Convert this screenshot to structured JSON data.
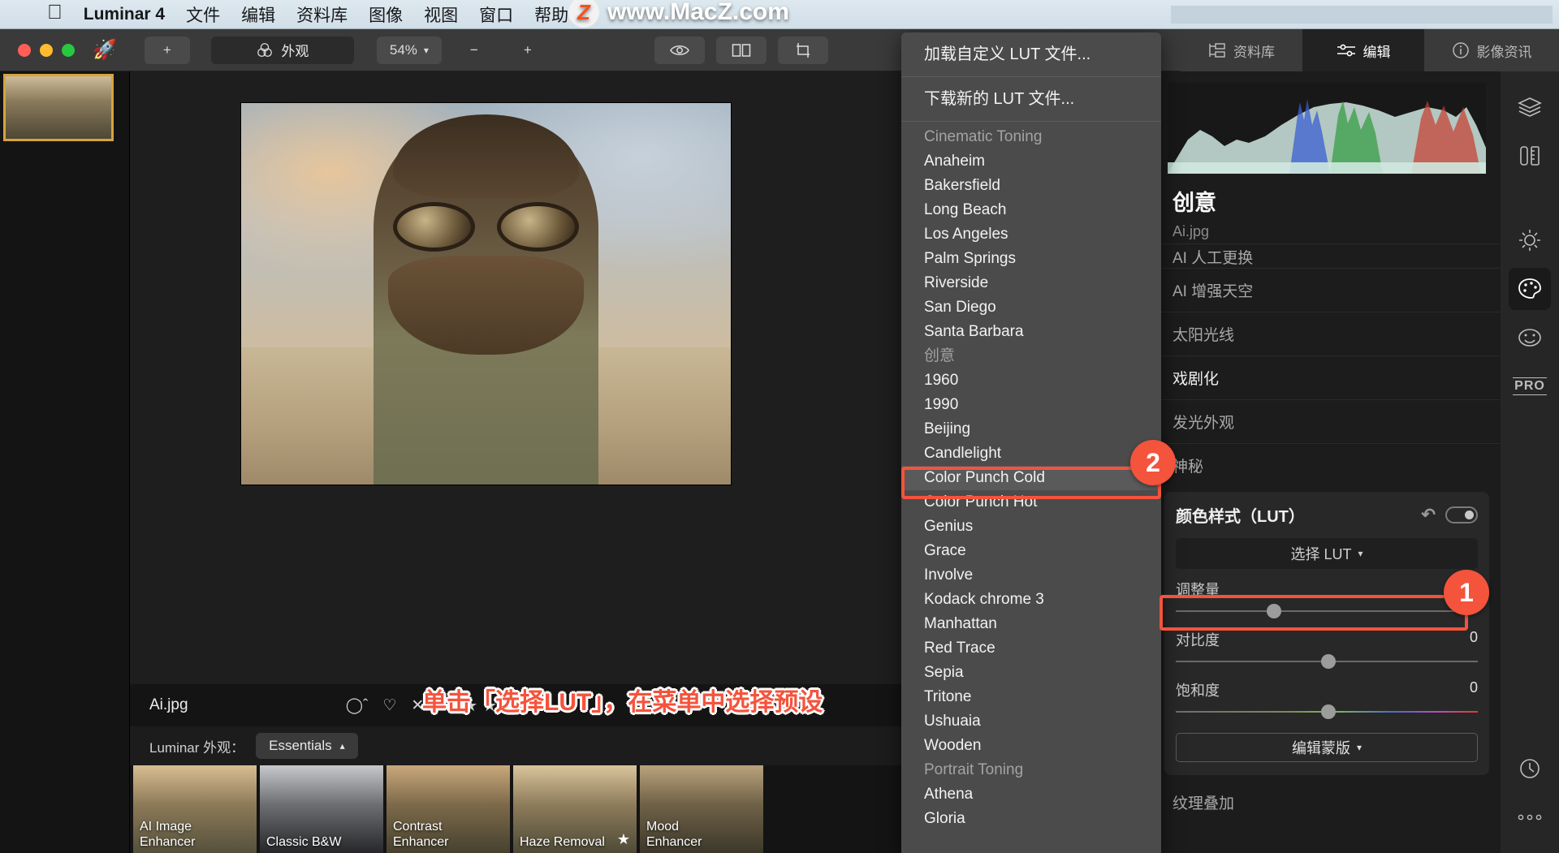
{
  "macbar": {
    "apple_icon": "apple-logo-icon",
    "app_name": "Luminar 4",
    "menus": [
      "文件",
      "编辑",
      "资料库",
      "图像",
      "视图",
      "窗口",
      "帮助"
    ]
  },
  "watermark": {
    "badge": "Z",
    "text": "www.MacZ.com"
  },
  "toolbar": {
    "add_label": "+",
    "looks_label": "外观",
    "zoom_label": "54%",
    "zoom_out": "−",
    "zoom_in": "+",
    "eye_icon": "eye-icon",
    "compare_icon": "split-view-icon",
    "crop_icon": "crop-icon",
    "tabs": [
      {
        "label": "资料库",
        "icon": "library-icon",
        "active": false
      },
      {
        "label": "编辑",
        "icon": "sliders-icon",
        "active": true
      },
      {
        "label": "影像资讯",
        "icon": "info-icon",
        "active": false
      }
    ]
  },
  "canvas": {
    "filename": "Ai.jpg"
  },
  "infobar": {
    "filename": "Ai.jpg",
    "reject_icon": "circle-icon",
    "favorite_icon": "heart-icon",
    "close_icon": "x-icon",
    "stars": [
      "★",
      "★",
      "★",
      "★",
      "★"
    ]
  },
  "looksbar": {
    "label": "Luminar 外观：",
    "collection": "Essentials"
  },
  "presets": [
    {
      "label": "AI Image\nEnhancer",
      "starred": false
    },
    {
      "label": "Classic B&W",
      "starred": false
    },
    {
      "label": "Contrast\nEnhancer",
      "starred": false
    },
    {
      "label": "Haze Removal",
      "starred": true
    },
    {
      "label": "Mood\nEnhancer",
      "starred": false
    }
  ],
  "rightpanel": {
    "title": "创意",
    "subtitle": "Ai.jpg",
    "rows": [
      {
        "label": "AI 人工更换",
        "strong": false
      },
      {
        "label": "AI 增强天空",
        "strong": false
      },
      {
        "label": "太阳光线",
        "strong": false
      },
      {
        "label": "戏剧化",
        "strong": true
      },
      {
        "label": "发光外观",
        "strong": false
      },
      {
        "label": "神秘",
        "strong": false
      }
    ],
    "lut_card": {
      "title": "颜色样式（LUT）",
      "reset_icon": "undo-icon",
      "toggle_icon": "toggle-switch",
      "select_label": "选择 LUT",
      "select_chevron": "chevron-down-icon",
      "sliders": [
        {
          "label": "调整量",
          "value": "30",
          "pos": 30,
          "rainbow": false
        },
        {
          "label": "对比度",
          "value": "0",
          "pos": 50,
          "rainbow": false
        },
        {
          "label": "饱和度",
          "value": "0",
          "pos": 50,
          "rainbow": true
        }
      ],
      "mask_label": "编辑蒙版"
    },
    "after_card": "纹理叠加"
  },
  "rail": {
    "icons": [
      {
        "name": "layers-icon",
        "active": false
      },
      {
        "name": "tools-icon",
        "active": false
      },
      {
        "name": "essentials-sun-icon",
        "active": false
      },
      {
        "name": "creative-palette-icon",
        "active": true
      },
      {
        "name": "portrait-face-icon",
        "active": false
      },
      {
        "name": "pro-icon",
        "active": false
      },
      {
        "name": "history-clock-icon",
        "active": false
      },
      {
        "name": "more-dots-icon",
        "active": false
      }
    ],
    "pro_label": "PRO"
  },
  "lut_menu": {
    "actions": [
      "加载自定义 LUT 文件...",
      "下载新的 LUT 文件..."
    ],
    "items": [
      {
        "label": "Cinematic Toning",
        "type": "header"
      },
      {
        "label": "Anaheim",
        "type": "item"
      },
      {
        "label": "Bakersfield",
        "type": "item"
      },
      {
        "label": "Long Beach",
        "type": "item"
      },
      {
        "label": "Los Angeles",
        "type": "item"
      },
      {
        "label": "Palm Springs",
        "type": "item"
      },
      {
        "label": "Riverside",
        "type": "item"
      },
      {
        "label": "San Diego",
        "type": "item"
      },
      {
        "label": "Santa Barbara",
        "type": "item"
      },
      {
        "label": "创意",
        "type": "header"
      },
      {
        "label": "1960",
        "type": "item"
      },
      {
        "label": "1990",
        "type": "item"
      },
      {
        "label": "Beijing",
        "type": "item"
      },
      {
        "label": "Candlelight",
        "type": "item"
      },
      {
        "label": "Color Punch Cold",
        "type": "item",
        "selected": true
      },
      {
        "label": "Color Punch Hot",
        "type": "item"
      },
      {
        "label": "Genius",
        "type": "item"
      },
      {
        "label": "Grace",
        "type": "item"
      },
      {
        "label": "Involve",
        "type": "item"
      },
      {
        "label": "Kodack chrome  3",
        "type": "item"
      },
      {
        "label": "Manhattan",
        "type": "item"
      },
      {
        "label": "Red Trace",
        "type": "item"
      },
      {
        "label": "Sepia",
        "type": "item"
      },
      {
        "label": "Tritone",
        "type": "item"
      },
      {
        "label": "Ushuaia",
        "type": "item"
      },
      {
        "label": "Wooden",
        "type": "item"
      },
      {
        "label": "Portrait Toning",
        "type": "header"
      },
      {
        "label": "Athena",
        "type": "item"
      },
      {
        "label": "Gloria",
        "type": "item"
      }
    ]
  },
  "annotations": {
    "num1": "1",
    "num2": "2",
    "instruction": "单击「选择LUT」，在菜单中选择预设",
    "accent_color": "#f4533c"
  }
}
